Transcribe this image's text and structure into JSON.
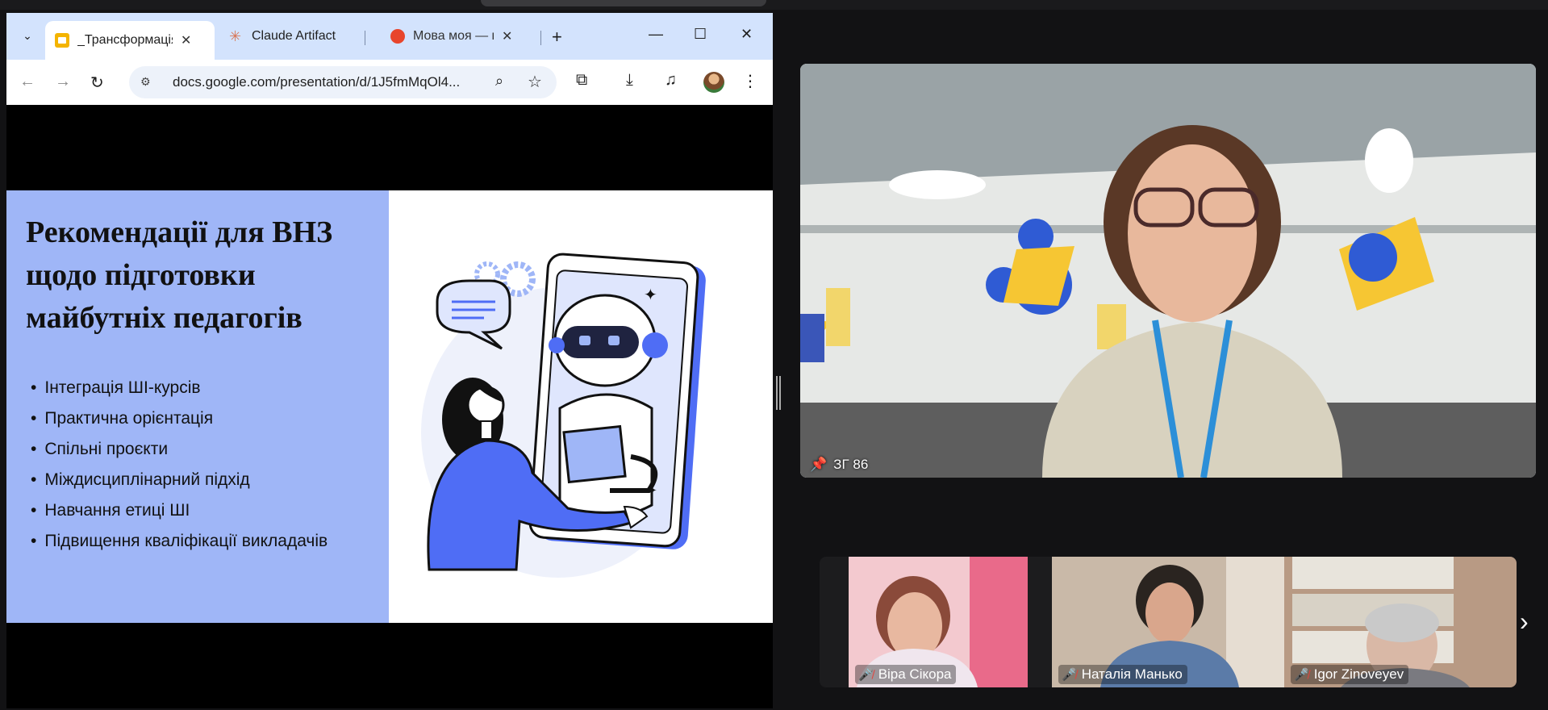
{
  "browser": {
    "tabs": [
      {
        "title": "_Трансформація",
        "active": true,
        "icon": "google-slides-icon"
      },
      {
        "title": "Claude Artifact",
        "active": false,
        "icon": "claude-icon"
      },
      {
        "title": "Мова моя — мо",
        "active": false,
        "icon": "site-icon"
      }
    ],
    "new_tab": "+",
    "url": "docs.google.com/presentation/d/1J5fmMqOl4..."
  },
  "slide": {
    "title": "Рекомендації для ВНЗ щодо підготовки майбутніх педагогів",
    "bullets": [
      "Інтеграція ШІ-курсів",
      "Практична орієнтація",
      "Спільні проєкти",
      "Міждисциплінарний підхід",
      "Навчання етиці ШІ",
      "Підвищення кваліфікації викладачів"
    ],
    "colors": {
      "left_panel": "#9fb6f7",
      "accent": "#4f6df5"
    }
  },
  "meeting": {
    "main_speaker_label": "ЗГ 86",
    "participants": [
      {
        "name": "Віра Сікора",
        "muted": true
      },
      {
        "name": "Наталія Манько",
        "muted": true
      },
      {
        "name": "Igor Zinoveyev",
        "muted": true
      }
    ]
  }
}
